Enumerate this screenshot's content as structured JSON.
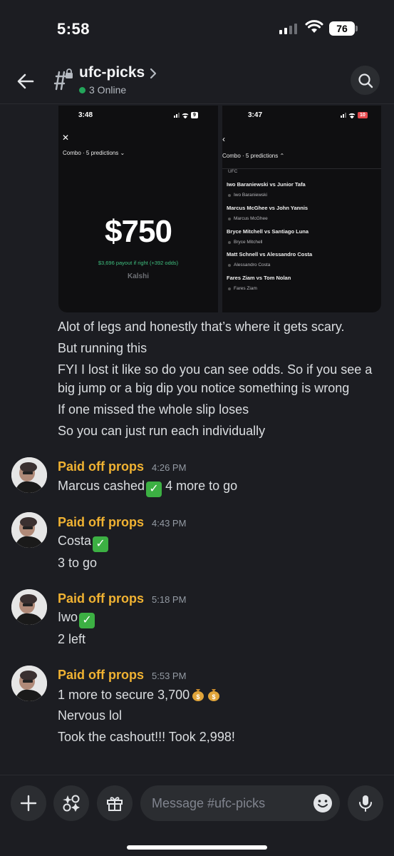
{
  "status_bar": {
    "time": "5:58",
    "battery": "76"
  },
  "header": {
    "channel_name": "ufc-picks",
    "online": "3 Online"
  },
  "attachment": {
    "left": {
      "time": "3:48",
      "battery": "9",
      "combo": "Combo · 5 predictions ⌄",
      "amount": "$750",
      "payout": "$3,696 payout if right (+392 odds)",
      "brand": "Kalshi"
    },
    "right": {
      "time": "3:47",
      "battery": "10",
      "combo": "Combo · 5 predictions ⌃",
      "section": "UFC",
      "fights": [
        {
          "title": "Iwo Baraniewski vs Junior Tafa",
          "pick": "Iwo Baraniewski"
        },
        {
          "title": "Marcus McGhee vs John Yannis",
          "pick": "Marcus McGhee"
        },
        {
          "title": "Bryce Mitchell vs Santiago Luna",
          "pick": "Bryce Mitchell"
        },
        {
          "title": "Matt Schnell vs Alessandro Costa",
          "pick": "Alessandro Costa"
        },
        {
          "title": "Fares Ziam vs Tom Nolan",
          "pick": "Fares Ziam"
        }
      ]
    }
  },
  "continued_lines": [
    "Alot of legs and honestly that’s where it gets scary.",
    "But running this",
    "FYI I lost it like so do you can see odds. So if you see a",
    "big jump or a big dip you notice something is wrong",
    "If one missed the whole slip loses",
    "So you can just run each individually"
  ],
  "messages": [
    {
      "author": "Paid off props",
      "time": "4:26 PM",
      "lines": [
        "Marcus cashed",
        " 4 more to go"
      ]
    },
    {
      "author": "Paid off props",
      "time": "4:43 PM",
      "lines": [
        "Costa",
        "3 to go"
      ]
    },
    {
      "author": "Paid off props",
      "time": "5:18 PM",
      "lines": [
        "Iwo",
        "2 left"
      ]
    },
    {
      "author": "Paid off props",
      "time": "5:53 PM",
      "lines": [
        "1 more to secure 3,700",
        "Nervous lol",
        "Took the cashout!!! Took 2,998!"
      ]
    }
  ],
  "composer": {
    "placeholder": "Message #ufc-picks"
  },
  "colors": {
    "author": "#f0b232",
    "online": "#23a55a",
    "background": "#1c1d22"
  }
}
